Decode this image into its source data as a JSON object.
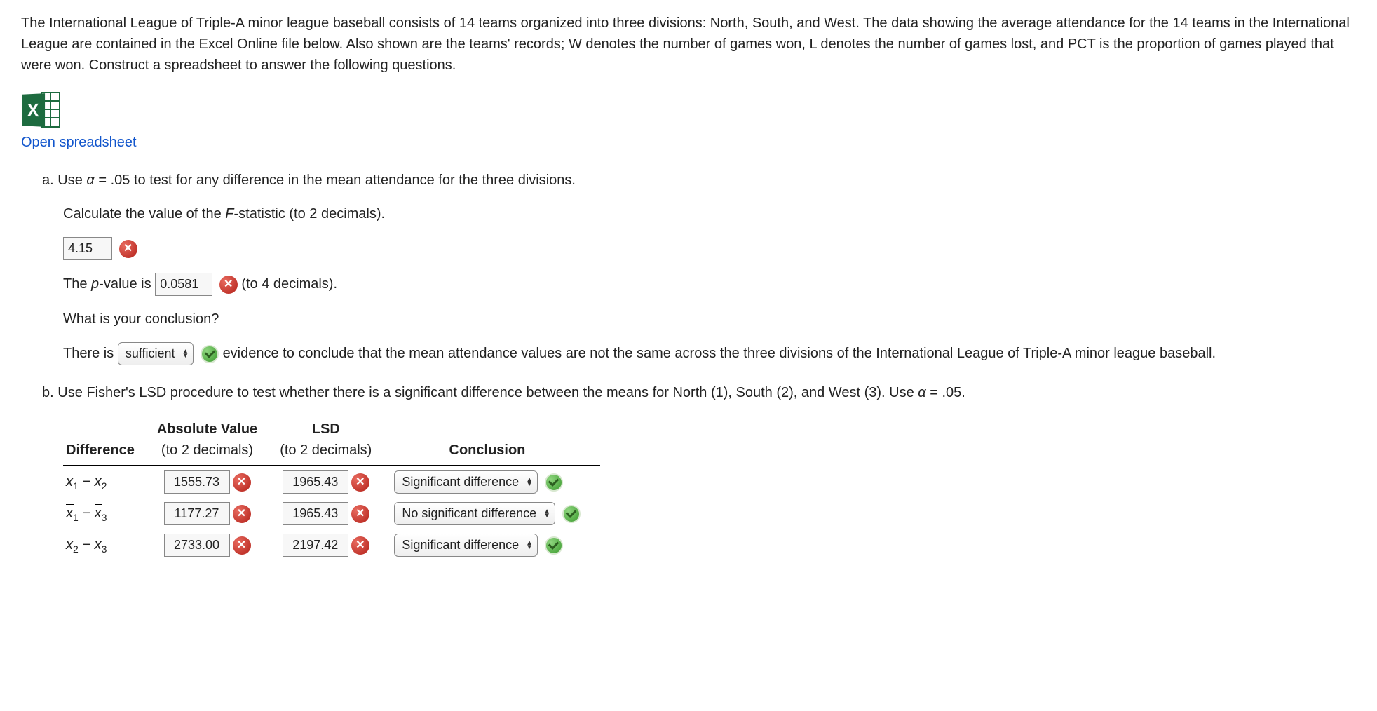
{
  "intro": "The International League of Triple-A minor league baseball consists of 14 teams organized into three divisions: North, South, and West. The data showing the average attendance for the 14 teams in the International League are contained in the Excel Online file below. Also shown are the teams' records; W denotes the number of games won, L denotes the number of games lost, and PCT is the proportion of games played that were won. Construct a spreadsheet to answer the following questions.",
  "open_link": "Open spreadsheet",
  "excel_X": "X",
  "qa": {
    "marker": "a.",
    "text_before_alpha": " Use ",
    "alpha_sym": "α",
    "alpha_expr": " = .05",
    "text_after_alpha": " to test for any difference in the mean attendance for the three divisions.",
    "calc_label_pre": "Calculate the value of the ",
    "F": "F",
    "calc_label_post": "-statistic (to 2 decimals).",
    "f_value": "4.15",
    "pvalue_pre": "The ",
    "p": "p",
    "pvalue_mid": "-value is ",
    "p_value": "0.0581",
    "pvalue_post": " (to 4 decimals).",
    "conclusion_q": "What is your conclusion?",
    "concl_pre": "There is ",
    "concl_select": "sufficient",
    "concl_post": " evidence to conclude that the mean attendance values are not the same across the three divisions of the International League of Triple-A minor league baseball."
  },
  "qb": {
    "marker": "b.",
    "text": " Use Fisher's LSD procedure to test whether there is a significant difference between the means for North (1), South (2), and West (3). Use ",
    "alpha_sym": "α",
    "alpha_expr": " = .05."
  },
  "table": {
    "headers": {
      "diff": "Difference",
      "abs_top": "Absolute Value",
      "abs_sub": "(to 2 decimals)",
      "lsd_top": "LSD",
      "lsd_sub": "(to 2 decimals)",
      "concl": "Conclusion"
    },
    "rows": [
      {
        "d_i": "1",
        "d_j": "2",
        "abs": "1555.73",
        "lsd": "1965.43",
        "concl": "Significant difference"
      },
      {
        "d_i": "1",
        "d_j": "3",
        "abs": "1177.27",
        "lsd": "1965.43",
        "concl": "No significant difference"
      },
      {
        "d_i": "2",
        "d_j": "3",
        "abs": "2733.00",
        "lsd": "2197.42",
        "concl": "Significant difference"
      }
    ]
  }
}
